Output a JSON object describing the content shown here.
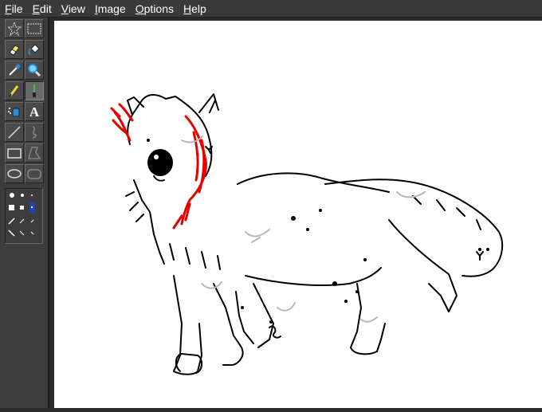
{
  "menu": {
    "items": [
      {
        "label": "File",
        "mnemonic": "F"
      },
      {
        "label": "Edit",
        "mnemonic": "E"
      },
      {
        "label": "View",
        "mnemonic": "V"
      },
      {
        "label": "Image",
        "mnemonic": "I"
      },
      {
        "label": "Options",
        "mnemonic": "O"
      },
      {
        "label": "Help",
        "mnemonic": "H"
      }
    ]
  },
  "toolbox": {
    "tools": [
      {
        "name": "free-select-tool",
        "icon": "star-select-icon"
      },
      {
        "name": "rect-select-tool",
        "icon": "rect-select-icon"
      },
      {
        "name": "eraser-tool",
        "icon": "eraser-icon"
      },
      {
        "name": "fill-tool",
        "icon": "paint-bucket-icon"
      },
      {
        "name": "color-picker-tool",
        "icon": "eyedropper-icon"
      },
      {
        "name": "magnifier-tool",
        "icon": "magnifier-icon"
      },
      {
        "name": "pencil-tool",
        "icon": "pencil-icon"
      },
      {
        "name": "brush-tool",
        "icon": "brush-icon"
      },
      {
        "name": "airbrush-tool",
        "icon": "airbrush-icon"
      },
      {
        "name": "text-tool",
        "icon": "text-icon",
        "glyph": "A"
      },
      {
        "name": "line-tool",
        "icon": "line-icon"
      },
      {
        "name": "curve-tool",
        "icon": "curve-icon"
      },
      {
        "name": "rectangle-tool",
        "icon": "rectangle-icon"
      },
      {
        "name": "polygon-tool",
        "icon": "polygon-icon"
      },
      {
        "name": "ellipse-tool",
        "icon": "ellipse-icon"
      },
      {
        "name": "rounded-rect-tool",
        "icon": "rounded-rectangle-icon"
      }
    ],
    "active_tool": "brush-tool",
    "options_panel": "brush-shape-options"
  },
  "colors": {
    "menubar": "#3a3a3a",
    "toolbox": "#3d3d3d",
    "canvas": "#ffffff",
    "ink": "#000000",
    "accent_red": "#e60000",
    "shade_gray": "#b8b8b8"
  }
}
